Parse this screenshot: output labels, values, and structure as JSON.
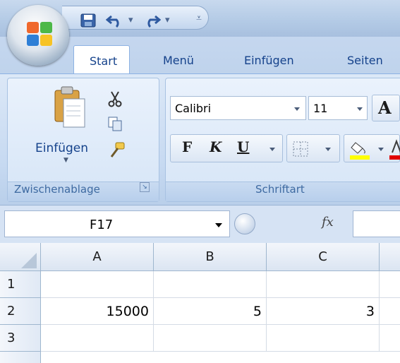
{
  "tabs": [
    "Start",
    "Menü",
    "Einfügen",
    "Seiten"
  ],
  "clipboard": {
    "paste_label": "Einfügen",
    "group_label": "Zwischenablage"
  },
  "font": {
    "name": "Calibri",
    "size": "11",
    "group_label": "Schriftart",
    "bold": "F",
    "italic": "K",
    "underline": "U"
  },
  "formula_bar": {
    "name_box": "F17",
    "fx": "fx",
    "content": ""
  },
  "grid": {
    "columns": [
      "A",
      "B",
      "C"
    ],
    "rows": [
      {
        "header": "1",
        "cells": [
          "",
          "",
          ""
        ]
      },
      {
        "header": "2",
        "cells": [
          "15000",
          "5",
          "3"
        ]
      },
      {
        "header": "3",
        "cells": [
          "",
          "",
          ""
        ]
      }
    ]
  },
  "colors": {
    "accent": "#15428b",
    "ribbon": "#c6d9f1",
    "highlight_yellow": "#ffff00",
    "font_red": "#e00000"
  }
}
